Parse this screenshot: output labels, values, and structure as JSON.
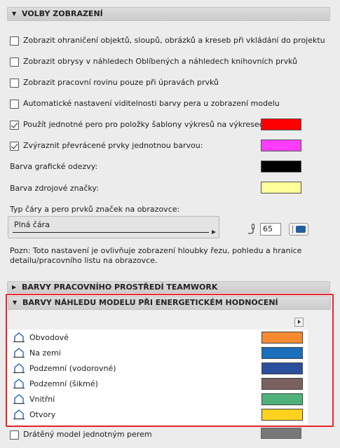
{
  "display_options": {
    "title": "VOLBY ZOBRAZENÍ",
    "checkboxes": [
      {
        "label": "Zobrazit ohraničení objektů, sloupů, obrázků a kreseb při vkládání do projektu",
        "checked": false
      },
      {
        "label": "Zobrazit obrysy v náhledech Oblíbených a náhledech knihovních prvků",
        "checked": false
      },
      {
        "label": "Zobrazit pracovní rovinu pouze při úpravách prvků",
        "checked": false
      },
      {
        "label": "Automatické nastavení viditelnosti barvy pera u zobrazení modelu",
        "checked": false
      },
      {
        "label": "Použít jednotné pero pro položky šablony výkresů na výkresech:",
        "checked": true,
        "color": "#ff0000"
      },
      {
        "label": "Zvýraznit převrácené prvky jednotnou barvou:",
        "checked": true,
        "color": "#ff3cff"
      }
    ],
    "feedback_color_label": "Barva grafické odezvy:",
    "feedback_color": "#000000",
    "source_marker_label": "Barva zdrojové značky:",
    "source_marker_color": "#ffff99",
    "line_type_label": "Typ čáry a pero prvků značek na obrazovce:",
    "line_type_value": "Plná čára",
    "pen_number": "65",
    "pen_color": "#1f5fa0",
    "note_line1": "Pozn: Toto nastavení je ovlivňuje zobrazení hloubky řezu, pohledu a hranice",
    "note_line2": "detailu/pracovního listu na obrazovce."
  },
  "teamwork": {
    "title": "BARVY PRACOVNÍHO PROSTŘEDÍ TEAMWORK"
  },
  "energy": {
    "title": "BARVY NÁHLEDU MODELU PŘI ENERGETICKÉM HODNOCENÍ",
    "rows": [
      {
        "label": "Obvodové",
        "icon": "house-outline-icon",
        "color": "#f58a30"
      },
      {
        "label": "Na zemi",
        "icon": "house-ground-icon",
        "color": "#1a6ebc"
      },
      {
        "label": "Podzemní (vodorovné)",
        "icon": "house-underground-horizontal-icon",
        "color": "#2a4f9c"
      },
      {
        "label": "Podzemní (šikmé)",
        "icon": "house-underground-sloped-icon",
        "color": "#7a6060"
      },
      {
        "label": "Vnitřní",
        "icon": "house-interior-icon",
        "color": "#4fb27a"
      },
      {
        "label": "Otvory",
        "icon": "house-openings-icon",
        "color": "#ffd21f"
      }
    ]
  },
  "wireframe": {
    "label": "Drátěný model jednotným perem",
    "checked": false,
    "color": "#777777"
  }
}
